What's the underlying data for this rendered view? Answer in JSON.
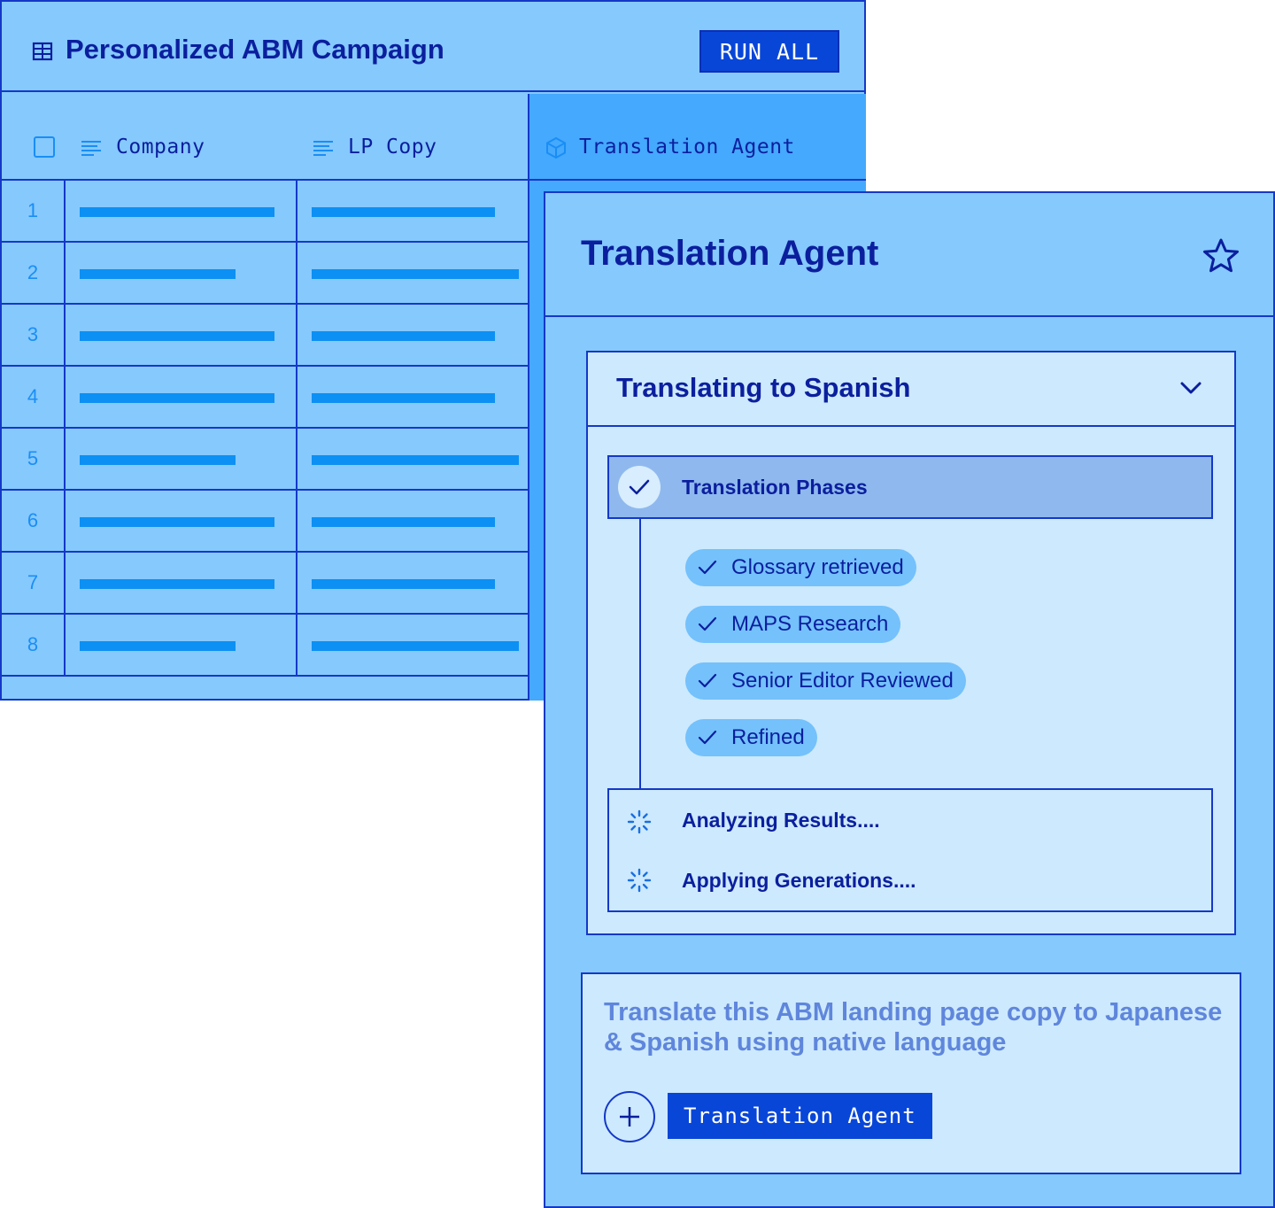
{
  "sheet": {
    "title": "Personalized ABM Campaign",
    "run_all_label": "RUN ALL",
    "columns": {
      "company": "Company",
      "lp_copy": "LP Copy",
      "agent": "Translation Agent"
    },
    "rows": [
      "1",
      "2",
      "3",
      "4",
      "5",
      "6",
      "7",
      "8"
    ]
  },
  "panel": {
    "title": "Translation Agent",
    "status_title": "Translating to Spanish",
    "phases_label": "Translation Phases",
    "steps": [
      "Glossary retrieved",
      "MAPS Research",
      "Senior Editor Reviewed",
      "Refined"
    ],
    "analyzing_label": "Analyzing Results....",
    "applying_label": "Applying Generations....",
    "prompt_text": "Translate this ABM landing page copy to Japanese & Spanish using native language",
    "agent_tag": "Translation Agent"
  },
  "colors": {
    "panel_bg": "#86c9fd",
    "card_bg": "#cde9fd",
    "border": "#1438c8",
    "text": "#0b1f9e",
    "accent": "#0846d8",
    "placeholder_bars": "#0c90f4"
  },
  "icons": [
    "table-icon",
    "lines-icon",
    "cube-icon",
    "star-icon",
    "chevron-down-icon",
    "check-icon",
    "spinner-icon",
    "plus-icon"
  ]
}
